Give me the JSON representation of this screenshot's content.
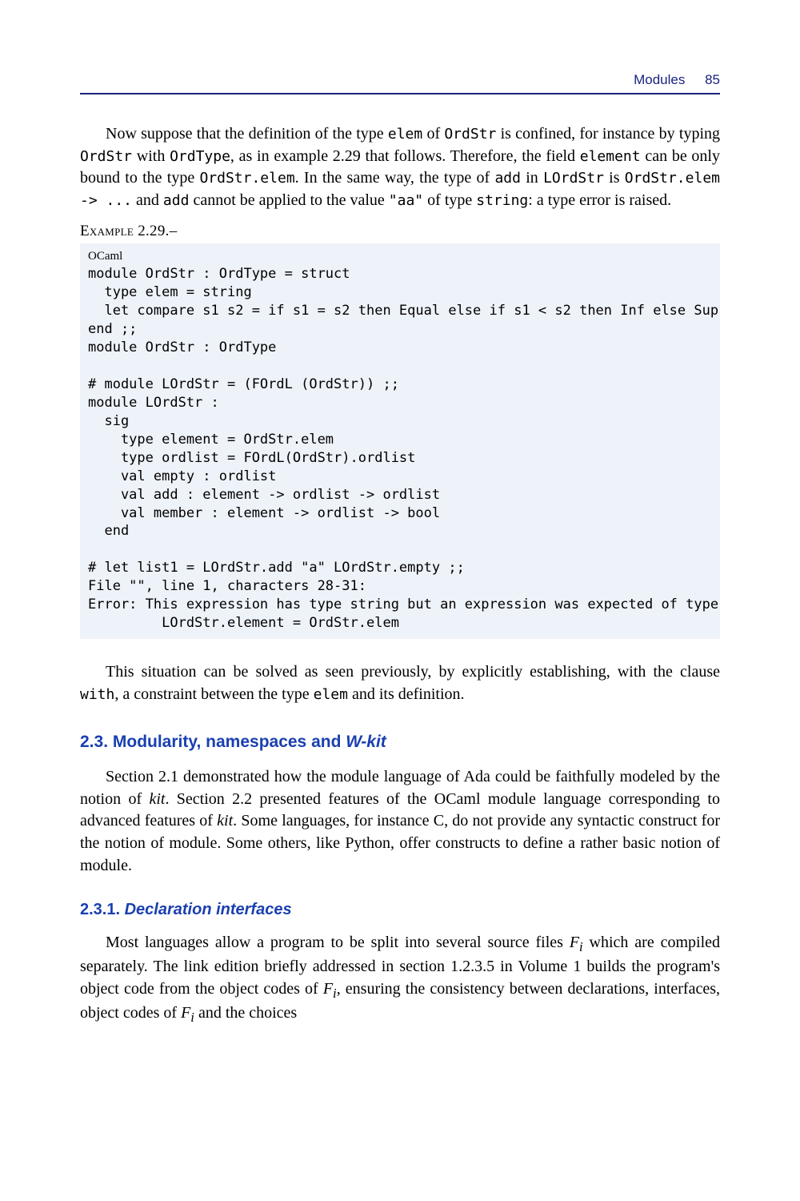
{
  "header": {
    "title": "Modules",
    "page": "85"
  },
  "para1": {
    "t1": "Now suppose that the definition of the type ",
    "c1": "elem",
    "t2": " of ",
    "c2": "OrdStr",
    "t3": " is confined, for instance by typing ",
    "c3": "OrdStr",
    "t4": " with ",
    "c4": "OrdType",
    "t5": ", as in example 2.29 that follows. Therefore, the field ",
    "c5": "element",
    "t6": " can be only bound to the type ",
    "c6": "OrdStr.elem",
    "t7": ". In the same way, the type of ",
    "c7": "add",
    "t8": " in ",
    "c8": "LOrdStr",
    "t9": " is  ",
    "c9": "OrdStr.elem -> ...",
    "t10": " and ",
    "c10": "add",
    "t11": " cannot be applied to the value ",
    "c11": "\"aa\"",
    "t12": " of type ",
    "c12": "string",
    "t13": ": a type error is raised."
  },
  "example_label": "Example 2.29.–",
  "code": {
    "lang": "OCaml",
    "body": "module OrdStr : OrdType = struct\n  type elem = string\n  let compare s1 s2 = if s1 = s2 then Equal else if s1 < s2 then Inf else Sup\nend ;;\nmodule OrdStr : OrdType\n\n# module LOrdStr = (FOrdL (OrdStr)) ;;\nmodule LOrdStr :\n  sig\n    type element = OrdStr.elem\n    type ordlist = FOrdL(OrdStr).ordlist\n    val empty : ordlist\n    val add : element -> ordlist -> ordlist\n    val member : element -> ordlist -> bool\n  end\n\n# let list1 = LOrdStr.add \"a\" LOrdStr.empty ;;\nFile \"\", line 1, characters 28-31:\nError: This expression has type string but an expression was expected of type\n         LOrdStr.element = OrdStr.elem"
  },
  "para2": {
    "t1": "This situation can be solved as seen previously, by explicitly establishing, with the clause ",
    "c1": "with",
    "t2": ", a constraint between the type ",
    "c2": "elem",
    "t3": " and its definition."
  },
  "sec23": {
    "num": "2.3. ",
    "text": "Modularity, namespaces and ",
    "em": "W-kit"
  },
  "para3": {
    "t1": "Section 2.1 demonstrated how the module language of Ada could be faithfully modeled by the notion of ",
    "e1": "kit",
    "t2": ". Section 2.2 presented features of the OCaml module language corresponding to advanced features of ",
    "e2": "kit",
    "t3": ". Some languages, for instance C, do not provide any syntactic construct for the notion of module. Some others, like Python, offer constructs to define a rather basic notion of module."
  },
  "sec231": {
    "num": "2.3.1. ",
    "em": "Declaration interfaces"
  },
  "para4": {
    "t1": "Most languages allow a program to be split into several source files ",
    "f1a": "F",
    "f1b": "i",
    "t2": " which are compiled separately. The link edition briefly addressed in section 1.2.3.5 in Volume 1 builds the program's object code from the object codes of ",
    "f2a": "F",
    "f2b": "i",
    "t3": ", ensuring the consistency between declarations, interfaces, object codes of ",
    "f3a": "F",
    "f3b": "i",
    "t4": " and the choices"
  }
}
